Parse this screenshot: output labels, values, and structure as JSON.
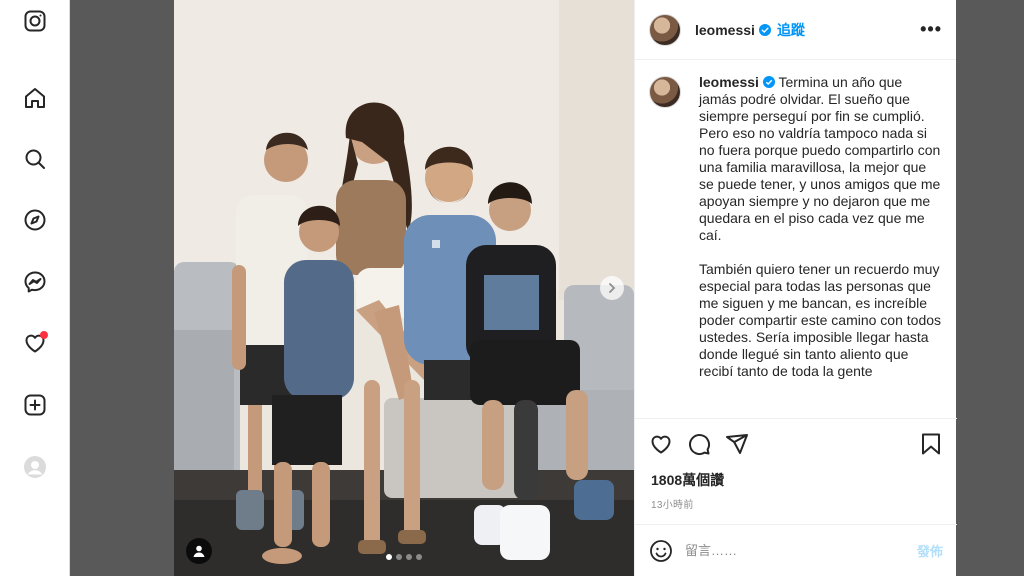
{
  "sidebar": {
    "icons": [
      "instagram-icon",
      "home-icon",
      "search-icon",
      "explore-icon",
      "messenger-icon",
      "notifications-icon",
      "create-icon",
      "profile-icon"
    ]
  },
  "post": {
    "username": "leomessi",
    "follow_label": "追蹤",
    "more_label": "•••",
    "caption_username": "leomessi",
    "caption_p1": "Termina un año que jamás podré olvidar. El sueño que siempre perseguí por fin se cumplió. Pero eso no valdría tampoco nada si no fuera porque puedo compartirlo con una familia maravillosa, la mejor que se puede tener, y unos amigos que me apoyan siempre y no dejaron que me quedara en el piso cada vez que me caí.",
    "caption_p2": "También quiero tener un recuerdo muy especial para todas las personas que me siguen y me bancan, es increíble poder compartir este camino con todos ustedes. Sería imposible llegar hasta donde llegué sin tanto aliento que recibí tanto de toda la gente",
    "views": "1808萬個讚",
    "time": "13小時前",
    "comment_placeholder": "留言……",
    "post_label": "發佈",
    "carousel": {
      "slides": 4,
      "active": 0
    }
  },
  "colors": {
    "accent": "#0095f6",
    "backdrop": "#000000",
    "notification_dot": "#ff3040"
  }
}
